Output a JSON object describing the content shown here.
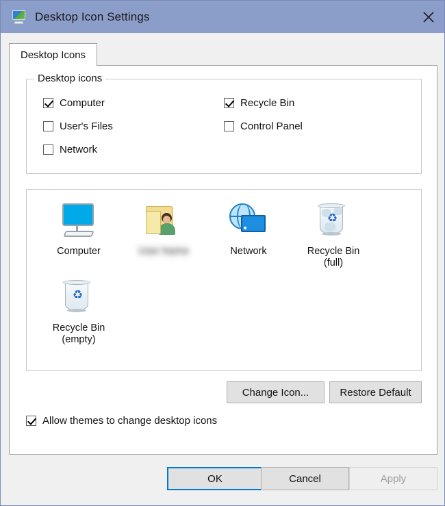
{
  "window": {
    "title": "Desktop Icon Settings",
    "icon": "display-settings-icon",
    "close_label": "✕",
    "titlebar_color": "#8b9dc9"
  },
  "tabs": [
    {
      "label": "Desktop Icons",
      "active": true
    }
  ],
  "desktop_icons_group": {
    "legend": "Desktop icons",
    "checkboxes": [
      {
        "label": "Computer",
        "checked": true,
        "column": "left",
        "row": 0
      },
      {
        "label": "User's Files",
        "checked": false,
        "column": "left",
        "row": 1
      },
      {
        "label": "Network",
        "checked": false,
        "column": "left",
        "row": 2
      },
      {
        "label": "Recycle Bin",
        "checked": true,
        "column": "right",
        "row": 0
      },
      {
        "label": "Control Panel",
        "checked": false,
        "column": "right",
        "row": 1
      }
    ]
  },
  "icon_preview": {
    "items": [
      {
        "label": "Computer",
        "icon": "computer-monitor-icon",
        "blurred": false
      },
      {
        "label": "User Name",
        "icon": "user-folder-icon",
        "blurred": true
      },
      {
        "label": "Network",
        "icon": "network-globe-icon",
        "blurred": false
      },
      {
        "label": "Recycle Bin\n(full)",
        "icon": "recycle-bin-full-icon",
        "blurred": false
      },
      {
        "label": "Recycle Bin\n(empty)",
        "icon": "recycle-bin-empty-icon",
        "blurred": false
      }
    ]
  },
  "icon_buttons": {
    "change_icon": "Change Icon...",
    "restore_default": "Restore Default"
  },
  "allow_themes": {
    "label": "Allow themes to change desktop icons",
    "checked": true
  },
  "dialog_buttons": {
    "ok": "OK",
    "cancel": "Cancel",
    "apply": "Apply",
    "default_button": "OK",
    "disabled_button": "Apply",
    "focus_color": "#0078d7"
  }
}
